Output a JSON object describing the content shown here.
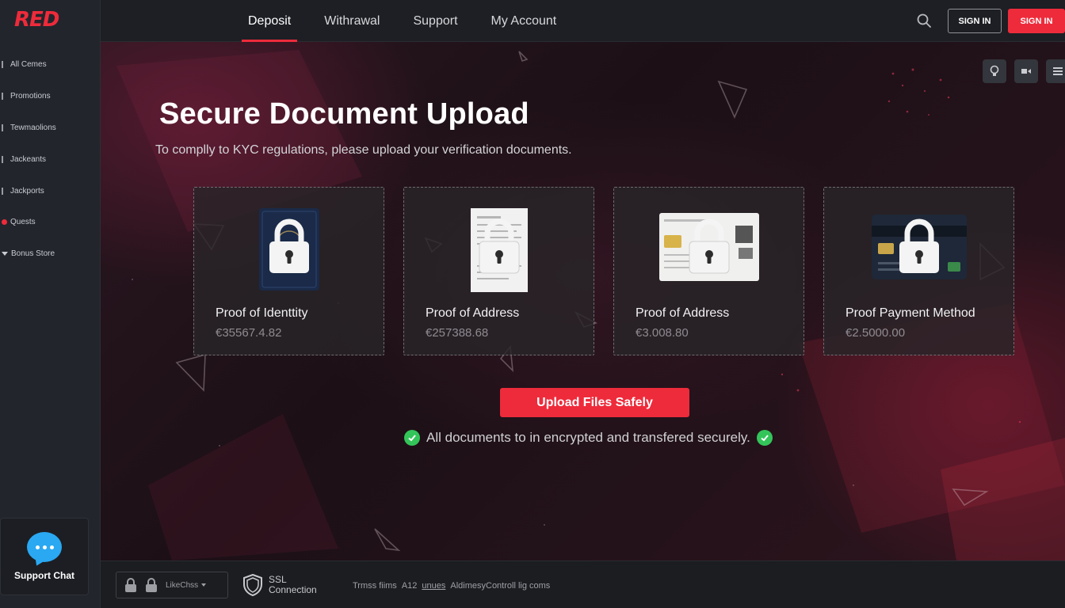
{
  "brand": {
    "logo_text": "RED",
    "accent": "#ee2b3b"
  },
  "sidebar": {
    "items": [
      {
        "label": "All Cemes"
      },
      {
        "label": "Promotions"
      },
      {
        "label": "Tewmaolions"
      },
      {
        "label": "Jackeants"
      },
      {
        "label": "Jackports"
      },
      {
        "label": "Quests"
      },
      {
        "label": "Bonus Store"
      }
    ],
    "support_chat_label": "Support Chat"
  },
  "topbar": {
    "nav": [
      {
        "label": "Deposit",
        "active": true
      },
      {
        "label": "Withrawal",
        "active": false
      },
      {
        "label": "Support",
        "active": false
      },
      {
        "label": "My Account",
        "active": false
      }
    ],
    "signin_outline_label": "SIGN IN",
    "signin_red_label": "SIGN IN"
  },
  "hero": {
    "title": "Secure Document Upload",
    "subtitle": "To complly to KYC regulations, please upload your verification documents."
  },
  "cards": [
    {
      "title": "Proof of Identtity",
      "value": "€35567.4.82",
      "icon": "passport-icon"
    },
    {
      "title": "Proof of Address",
      "value": "€257388.68",
      "icon": "utility-bill-icon"
    },
    {
      "title": "Proof of Address",
      "value": "€3.008.80",
      "icon": "id-card-icon"
    },
    {
      "title": "Proof Payment Method",
      "value": "€2.5000.00",
      "icon": "bank-card-icon"
    }
  ],
  "upload_button_label": "Upload Files Safely",
  "secure_note": "All documents to in encrypted and transfered securely.",
  "footer": {
    "lang_label": "LikeChss",
    "ssl_line1": "SSL",
    "ssl_line2": "Connection",
    "links": [
      "Trmss fiims",
      "A12",
      "unues",
      "AldimesyControll lig coms"
    ]
  }
}
